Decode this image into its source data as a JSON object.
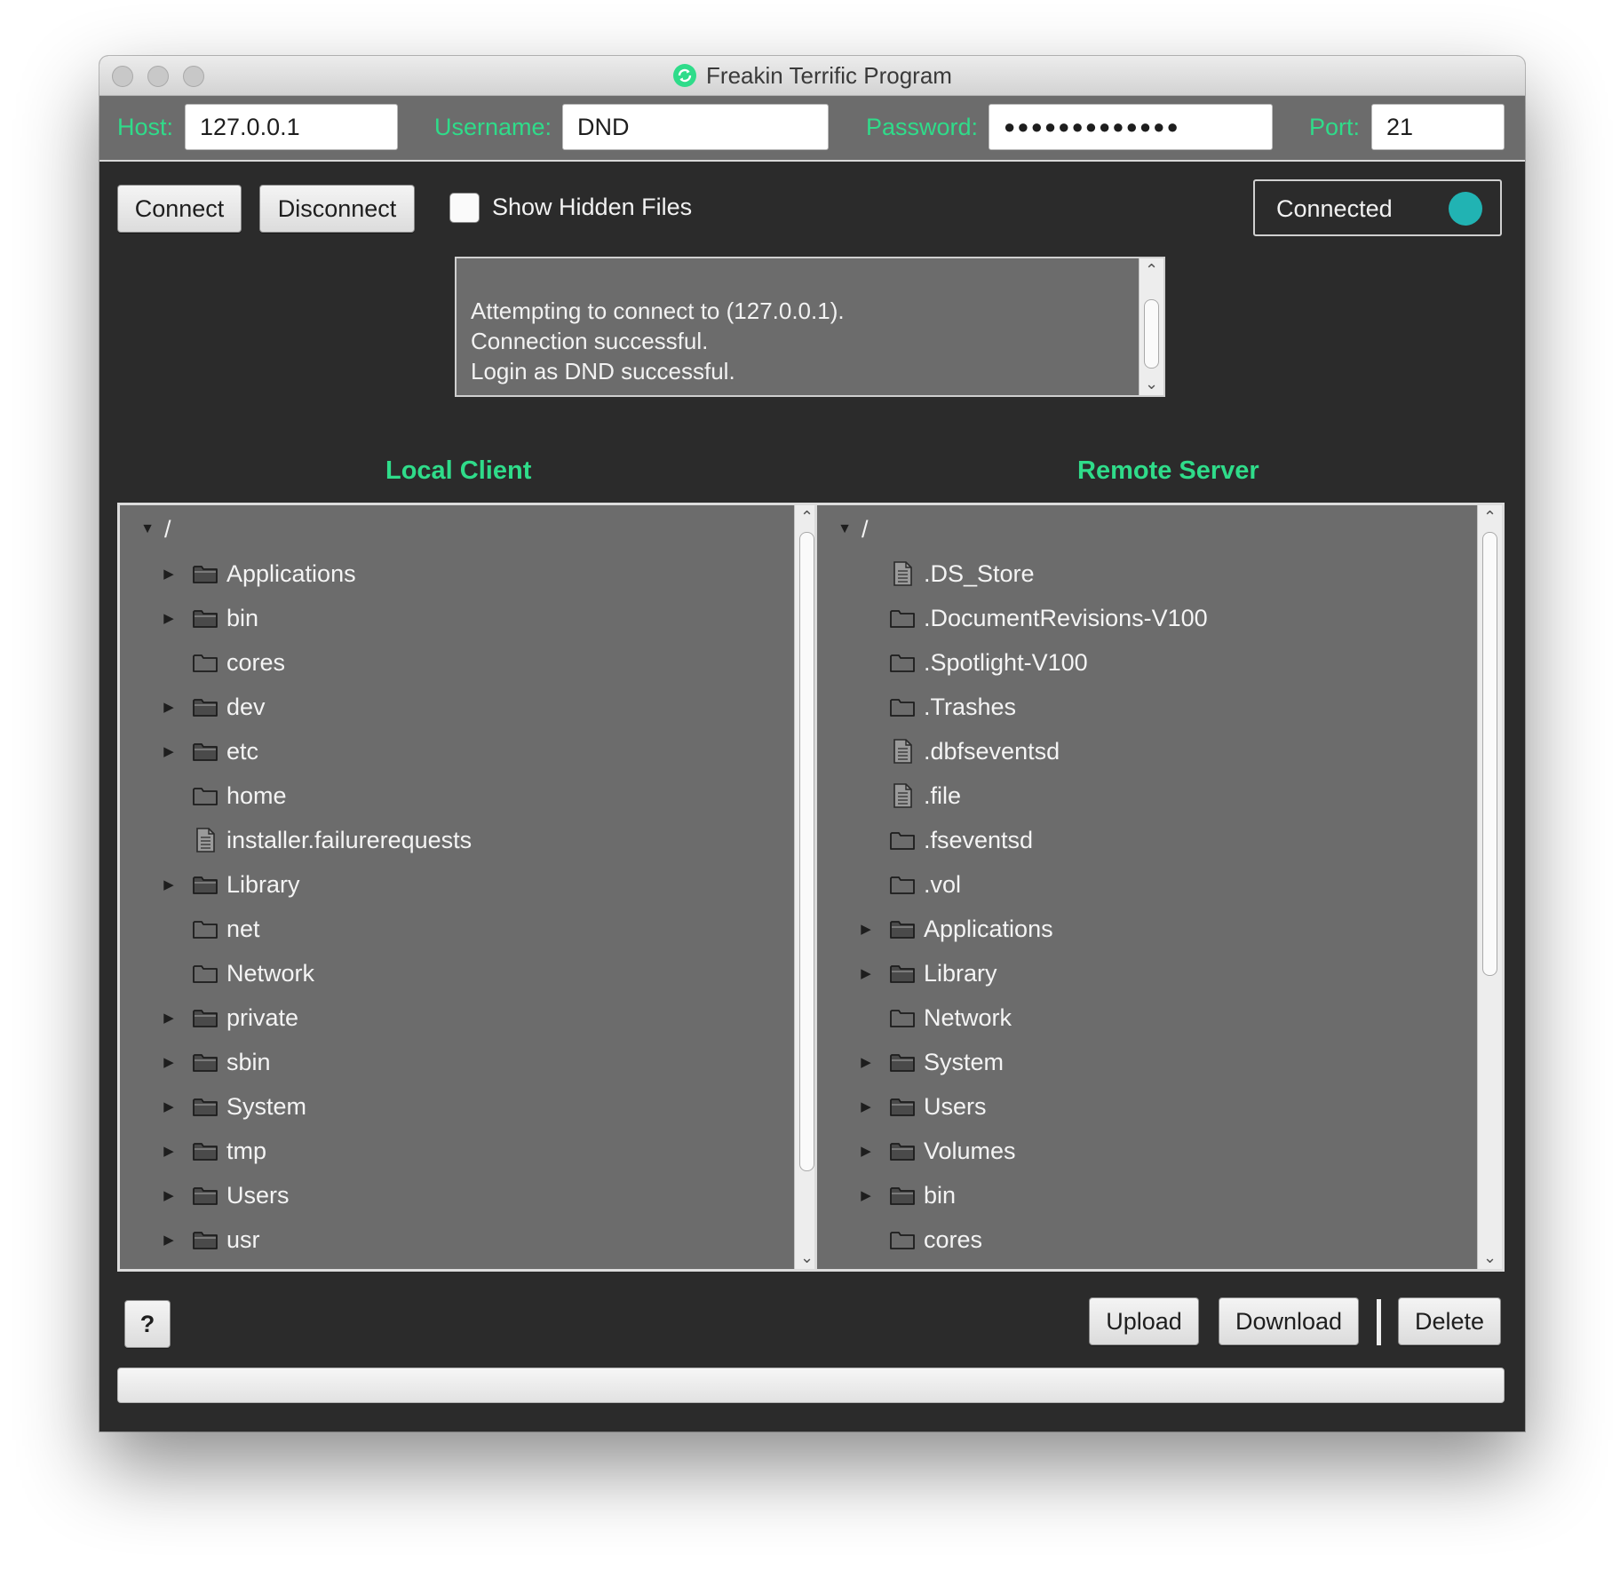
{
  "window": {
    "title": "Freakin Terrific Program",
    "title_icon": "refresh-circle-icon"
  },
  "connection": {
    "host_label": "Host:",
    "host_value": "127.0.0.1",
    "username_label": "Username:",
    "username_value": "DND",
    "password_label": "Password:",
    "password_value": "●●●●●●●●●●●●●",
    "port_label": "Port:",
    "port_value": "21"
  },
  "toolbar": {
    "connect_label": "Connect",
    "disconnect_label": "Disconnect",
    "show_hidden_label": "Show Hidden Files",
    "show_hidden_checked": false
  },
  "status": {
    "text": "Connected",
    "indicator_color": "#21b3b3"
  },
  "log": {
    "lines": [
      "Attempting to connect to (127.0.0.1).",
      "Connection successful.",
      "Login as DND successful."
    ]
  },
  "local": {
    "title": "Local Client",
    "root": "/",
    "items": [
      {
        "name": "Applications",
        "type": "folder",
        "expandable": true
      },
      {
        "name": "bin",
        "type": "folder",
        "expandable": true
      },
      {
        "name": "cores",
        "type": "folder",
        "expandable": false
      },
      {
        "name": "dev",
        "type": "folder",
        "expandable": true
      },
      {
        "name": "etc",
        "type": "folder",
        "expandable": true
      },
      {
        "name": "home",
        "type": "folder",
        "expandable": false
      },
      {
        "name": "installer.failurerequests",
        "type": "file",
        "expandable": false
      },
      {
        "name": "Library",
        "type": "folder",
        "expandable": true
      },
      {
        "name": "net",
        "type": "folder",
        "expandable": false
      },
      {
        "name": "Network",
        "type": "folder",
        "expandable": false
      },
      {
        "name": "private",
        "type": "folder",
        "expandable": true
      },
      {
        "name": "sbin",
        "type": "folder",
        "expandable": true
      },
      {
        "name": "System",
        "type": "folder",
        "expandable": true
      },
      {
        "name": "tmp",
        "type": "folder",
        "expandable": true
      },
      {
        "name": "Users",
        "type": "folder",
        "expandable": true
      },
      {
        "name": "usr",
        "type": "folder",
        "expandable": true
      }
    ]
  },
  "remote": {
    "title": "Remote Server",
    "root": "/",
    "items": [
      {
        "name": ".DS_Store",
        "type": "file",
        "expandable": false
      },
      {
        "name": ".DocumentRevisions-V100",
        "type": "folder",
        "expandable": false
      },
      {
        "name": ".Spotlight-V100",
        "type": "folder",
        "expandable": false
      },
      {
        "name": ".Trashes",
        "type": "folder",
        "expandable": false
      },
      {
        "name": ".dbfseventsd",
        "type": "file",
        "expandable": false
      },
      {
        "name": ".file",
        "type": "file",
        "expandable": false
      },
      {
        "name": ".fseventsd",
        "type": "folder",
        "expandable": false
      },
      {
        "name": ".vol",
        "type": "folder",
        "expandable": false
      },
      {
        "name": "Applications",
        "type": "folder",
        "expandable": true
      },
      {
        "name": "Library",
        "type": "folder",
        "expandable": true
      },
      {
        "name": "Network",
        "type": "folder",
        "expandable": false
      },
      {
        "name": "System",
        "type": "folder",
        "expandable": true
      },
      {
        "name": "Users",
        "type": "folder",
        "expandable": true
      },
      {
        "name": "Volumes",
        "type": "folder",
        "expandable": true
      },
      {
        "name": "bin",
        "type": "folder",
        "expandable": true
      },
      {
        "name": "cores",
        "type": "folder",
        "expandable": false
      }
    ]
  },
  "actions": {
    "help_label": "?",
    "upload_label": "Upload",
    "download_label": "Download",
    "delete_label": "Delete"
  },
  "progress": {
    "value": 0
  },
  "colors": {
    "accent": "#2fdc8a",
    "panel": "#6c6c6c",
    "background": "#2b2b2b"
  }
}
